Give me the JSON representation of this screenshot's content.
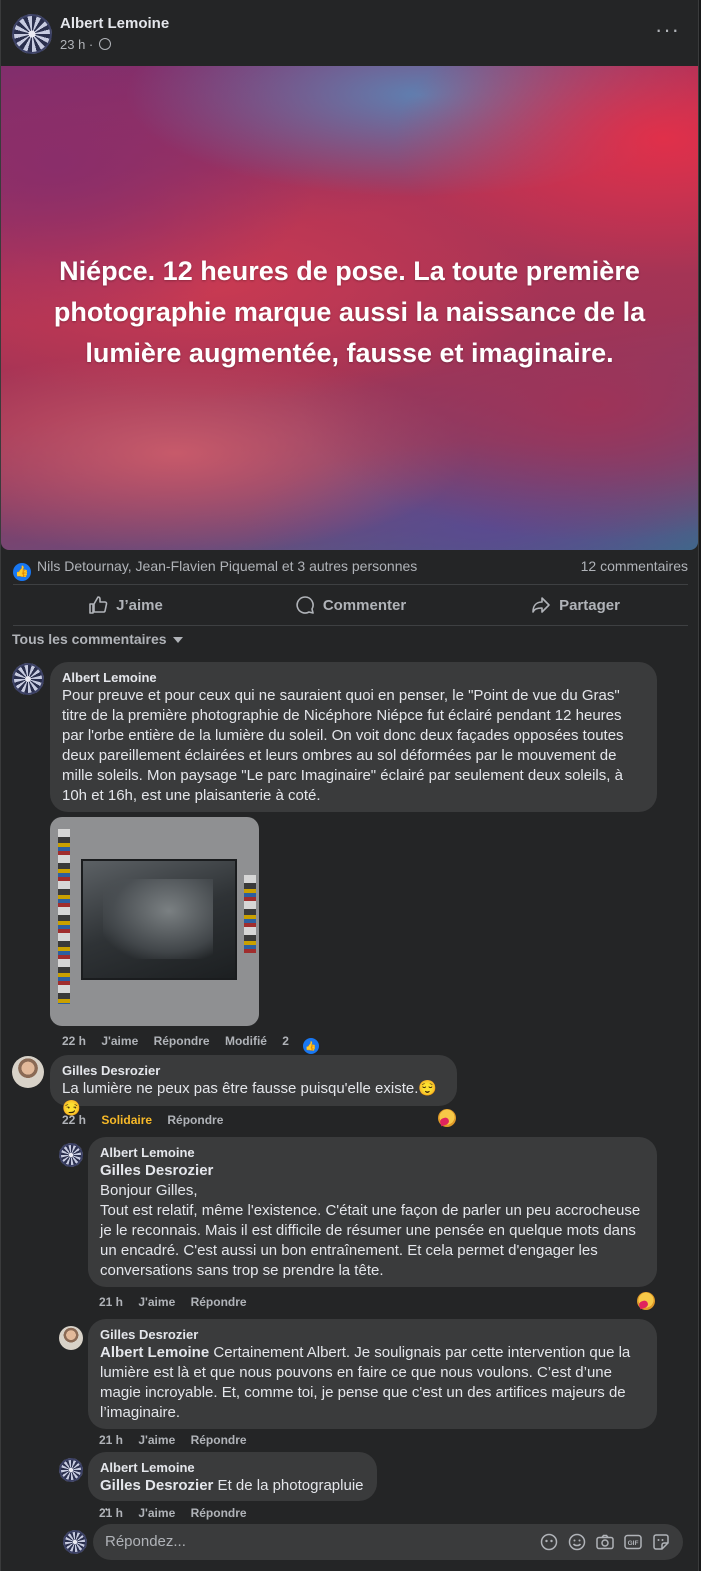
{
  "post": {
    "author": "Albert Lemoine",
    "time": "23 h ·",
    "more_label": "···",
    "banner_text": "Niépce. 12 heures de pose. La toute première photographie marque aussi la naissance de la lumière augmentée, fausse et imaginaire.",
    "banner_colors": [
      "#8a2e6a",
      "#e0304a",
      "#5f7fb0",
      "#c75a6a",
      "#5a4a90"
    ],
    "reactions_text": "Nils Detournay, Jean-Flavien Piquemal et 3 autres personnes",
    "comments_count": "12 commentaires",
    "actions": {
      "like": "J’aime",
      "comment": "Commenter",
      "share": "Partager"
    },
    "sort_label": "Tous les commentaires"
  },
  "comments": {
    "c1": {
      "author": "Albert Lemoine",
      "text": "Pour preuve et pour ceux qui ne sauraient quoi en penser, le \"Point de vue du Gras\" titre de la première photographie de Nicéphore Niépce fut éclairé pendant 12 heures par l'orbe entière de la lumière du soleil. On voit donc deux façades opposées toutes deux pareillement éclairées et leurs ombres au sol déformées par le mouvement de mille soleils. Mon paysage \"Le parc Imaginaire\" éclairé par seulement deux soleils, à 10h et 16h, est une plaisanterie à coté.",
      "time": "22 h",
      "like": "J'aime",
      "reply": "Répondre",
      "edited": "Modifié",
      "likes": "2"
    },
    "c2": {
      "author": "Gilles Desrozier",
      "text": "La lumière ne peux pas être fausse puisqu'elle existe.😌😏",
      "time": "22 h",
      "reaction_label": "Solidaire",
      "reply": "Répondre"
    },
    "r1": {
      "author": "Albert Lemoine",
      "mention": "Gilles Desrozier",
      "text": "Bonjour Gilles,\nTout est relatif, même l'existence. C'était une façon de parler un peu accrocheuse je le reconnais. Mais il est difficile de résumer une pensée en quelque mots dans un encadré. C'est aussi un bon entraînement. Et cela permet d'engager les conversations sans trop se prendre la tête.",
      "time": "21 h",
      "like": "J'aime",
      "reply": "Répondre"
    },
    "r2": {
      "author": "Gilles Desrozier",
      "mention": "Albert Lemoine",
      "text": " Certainement Albert. Je soulignais par cette intervention que la lumière est là et que nous pouvons en faire ce que nous voulons. C’est d’une magie incroyable. Et, comme toi, je pense que c'est un des artifices majeurs de l’imaginaire.",
      "time": "21 h",
      "like": "J'aime",
      "reply": "Répondre"
    },
    "r3": {
      "author": "Albert Lemoine",
      "mention": "Gilles Desrozier",
      "text": " Et de la photograpluie ..",
      "time": "21 h",
      "like": "J'aime",
      "reply": "Répondre"
    }
  },
  "composer": {
    "placeholder": "Répondez..."
  },
  "icons": [
    "globe-icon",
    "more-icon",
    "like-icon",
    "comment-icon",
    "share-icon",
    "caret-down-icon",
    "care-reaction-icon",
    "avatar-icon",
    "sticker-icon",
    "emoji-icon",
    "camera-icon",
    "gif-icon",
    "emoji-sticker-icon"
  ],
  "colors": {
    "accent": "#1877f2",
    "solidaire": "#f7b928",
    "bubble": "#3a3b3c",
    "card": "#242526"
  }
}
